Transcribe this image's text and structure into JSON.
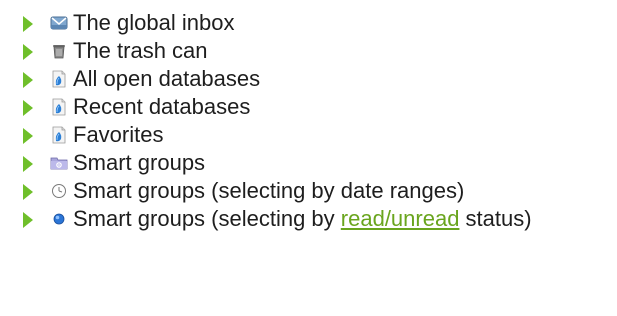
{
  "items": [
    {
      "label": "The global inbox",
      "icon": "inbox-icon"
    },
    {
      "label": "The trash can",
      "icon": "trash-can-icon"
    },
    {
      "label": "All open databases",
      "icon": "database-icon"
    },
    {
      "label": "Recent databases",
      "icon": "database-icon"
    },
    {
      "label": "Favorites",
      "icon": "database-icon"
    },
    {
      "label": "Smart groups",
      "icon": "smart-group-folder-icon"
    },
    {
      "label": "Smart groups (selecting by date ranges)",
      "icon": "clock-icon"
    },
    {
      "label_before": "Smart groups (selecting by ",
      "label_link": "read/unread",
      "label_after": " status)",
      "icon": "blue-dot-icon"
    }
  ],
  "colors": {
    "disclosure_triangle": "#6fbf2a",
    "link": "#6aa51e",
    "text": "#1e1e1e"
  }
}
